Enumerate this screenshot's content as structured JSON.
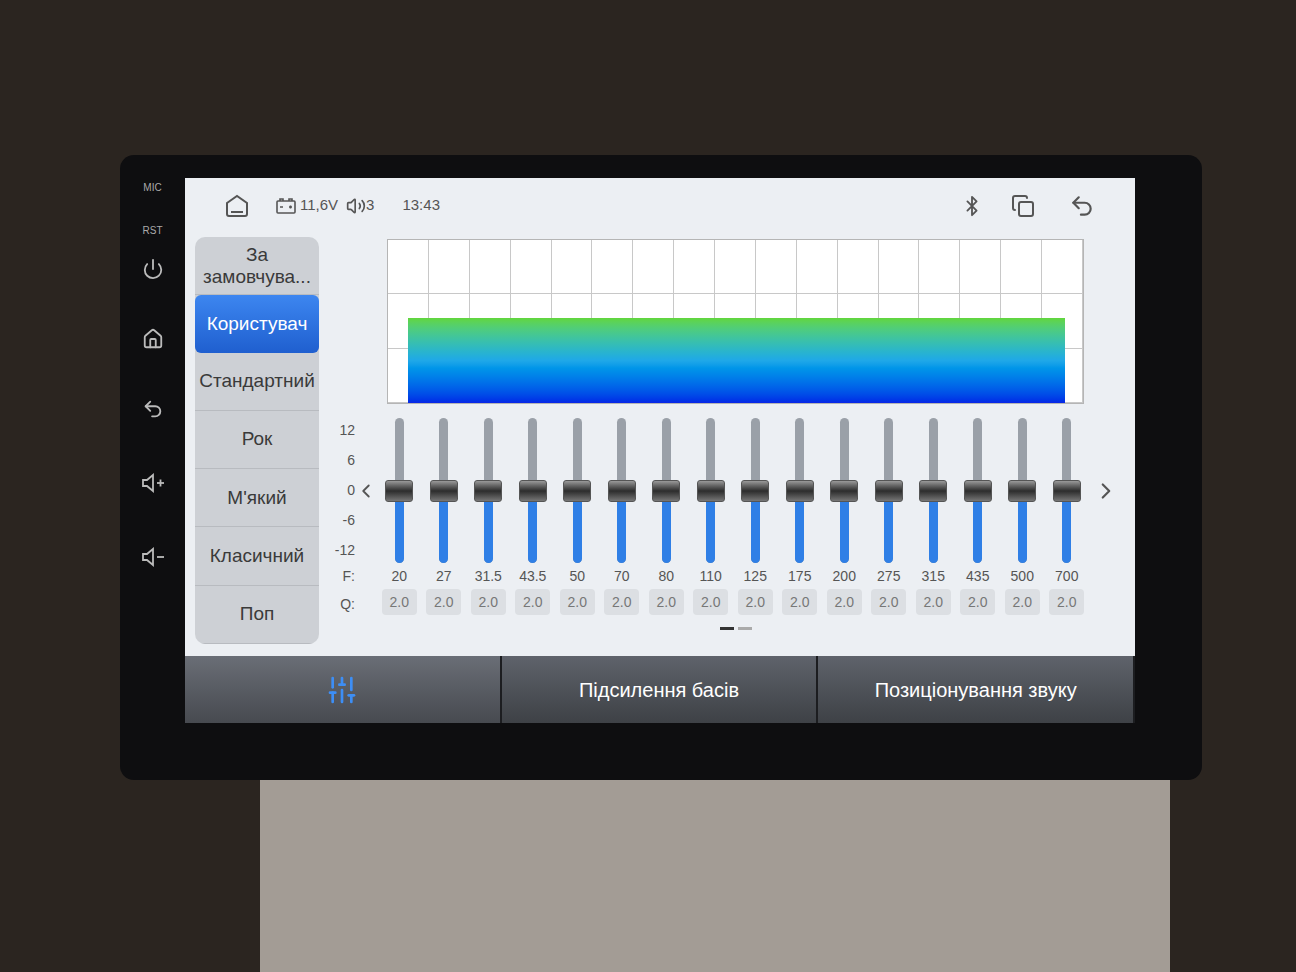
{
  "bezel": {
    "labels": [
      "MIC",
      "RST"
    ]
  },
  "status_bar": {
    "voltage": "11,6V",
    "volume": "3",
    "time": "13:43"
  },
  "sidebar": {
    "items": [
      {
        "label": "За замовчува...",
        "selected": false
      },
      {
        "label": "Користувач",
        "selected": true
      },
      {
        "label": "Стандартний",
        "selected": false
      },
      {
        "label": "Рок",
        "selected": false
      },
      {
        "label": "М'який",
        "selected": false
      },
      {
        "label": "Класичний",
        "selected": false
      },
      {
        "label": "Поп",
        "selected": false
      }
    ]
  },
  "chart": {
    "values": [
      0,
      0,
      0,
      0,
      0,
      0,
      0,
      0,
      0,
      0,
      0,
      0,
      0,
      0,
      0,
      0
    ]
  },
  "axis": {
    "ticks": [
      "12",
      "6",
      "0",
      "-6",
      "-12"
    ],
    "f_label": "F:",
    "q_label": "Q:"
  },
  "sliders": [
    {
      "freq": "20",
      "q": "2.0",
      "level": 0.5
    },
    {
      "freq": "27",
      "q": "2.0",
      "level": 0.5
    },
    {
      "freq": "31.5",
      "q": "2.0",
      "level": 0.5
    },
    {
      "freq": "43.5",
      "q": "2.0",
      "level": 0.5
    },
    {
      "freq": "50",
      "q": "2.0",
      "level": 0.5
    },
    {
      "freq": "70",
      "q": "2.0",
      "level": 0.5
    },
    {
      "freq": "80",
      "q": "2.0",
      "level": 0.5
    },
    {
      "freq": "110",
      "q": "2.0",
      "level": 0.5
    },
    {
      "freq": "125",
      "q": "2.0",
      "level": 0.5
    },
    {
      "freq": "175",
      "q": "2.0",
      "level": 0.5
    },
    {
      "freq": "200",
      "q": "2.0",
      "level": 0.5
    },
    {
      "freq": "275",
      "q": "2.0",
      "level": 0.5
    },
    {
      "freq": "315",
      "q": "2.0",
      "level": 0.5
    },
    {
      "freq": "435",
      "q": "2.0",
      "level": 0.5
    },
    {
      "freq": "500",
      "q": "2.0",
      "level": 0.5
    },
    {
      "freq": "700",
      "q": "2.0",
      "level": 0.5
    }
  ],
  "page_dots": [
    {
      "selected": true
    },
    {
      "selected": false
    }
  ],
  "tabs": [
    {
      "kind": "icon",
      "selected": true
    },
    {
      "kind": "text",
      "label": "Підсилення басів",
      "selected": false
    },
    {
      "kind": "text",
      "label": "Позиціонування звуку",
      "selected": false
    }
  ]
}
